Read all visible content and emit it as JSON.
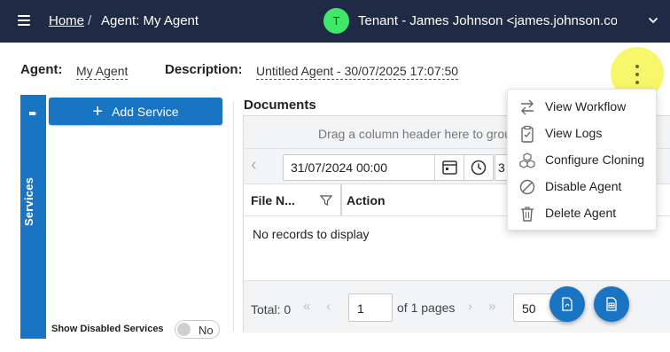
{
  "topbar": {
    "breadcrumb_home": "Home",
    "breadcrumb_separator": "/",
    "breadcrumb_current": "Agent: My Agent",
    "avatar_letter": "T",
    "avatar_color": "#3fe86a",
    "tenant_text": "Tenant - James Johnson <james.johnson.com...",
    "background_color": "#1f2a44"
  },
  "agent": {
    "agent_label": "Agent:",
    "agent_value": "My Agent",
    "description_label": "Description:",
    "description_value": "Untitled Agent - 30/07/2025 17:07:50"
  },
  "services": {
    "tab_label": "Services",
    "add_button_label": "Add Service",
    "show_disabled_label": "Show Disabled Services",
    "show_disabled_toggle": "No",
    "accent_color": "#1a74c4"
  },
  "documents": {
    "title": "Documents",
    "group_hint": "Drag a column header here to grou",
    "date_filter_value": "31/07/2024 00:00",
    "date_filter_value_2": "3",
    "columns": [
      "File N...",
      "Action"
    ],
    "empty_message": "No records to display",
    "pager": {
      "total_label": "Total: 0",
      "page_value": "1",
      "of_pages": "of 1 pages",
      "page_size": "50"
    }
  },
  "menu": {
    "items": [
      {
        "label": "View Workflow",
        "icon": "arrows-exchange-icon"
      },
      {
        "label": "View Logs",
        "icon": "clipboard-check-icon"
      },
      {
        "label": "Configure Cloning",
        "icon": "cubes-icon"
      },
      {
        "label": "Disable Agent",
        "icon": "ban-icon"
      },
      {
        "label": "Delete Agent",
        "icon": "trash-icon"
      }
    ]
  },
  "highlight_color": "#f7f55a"
}
